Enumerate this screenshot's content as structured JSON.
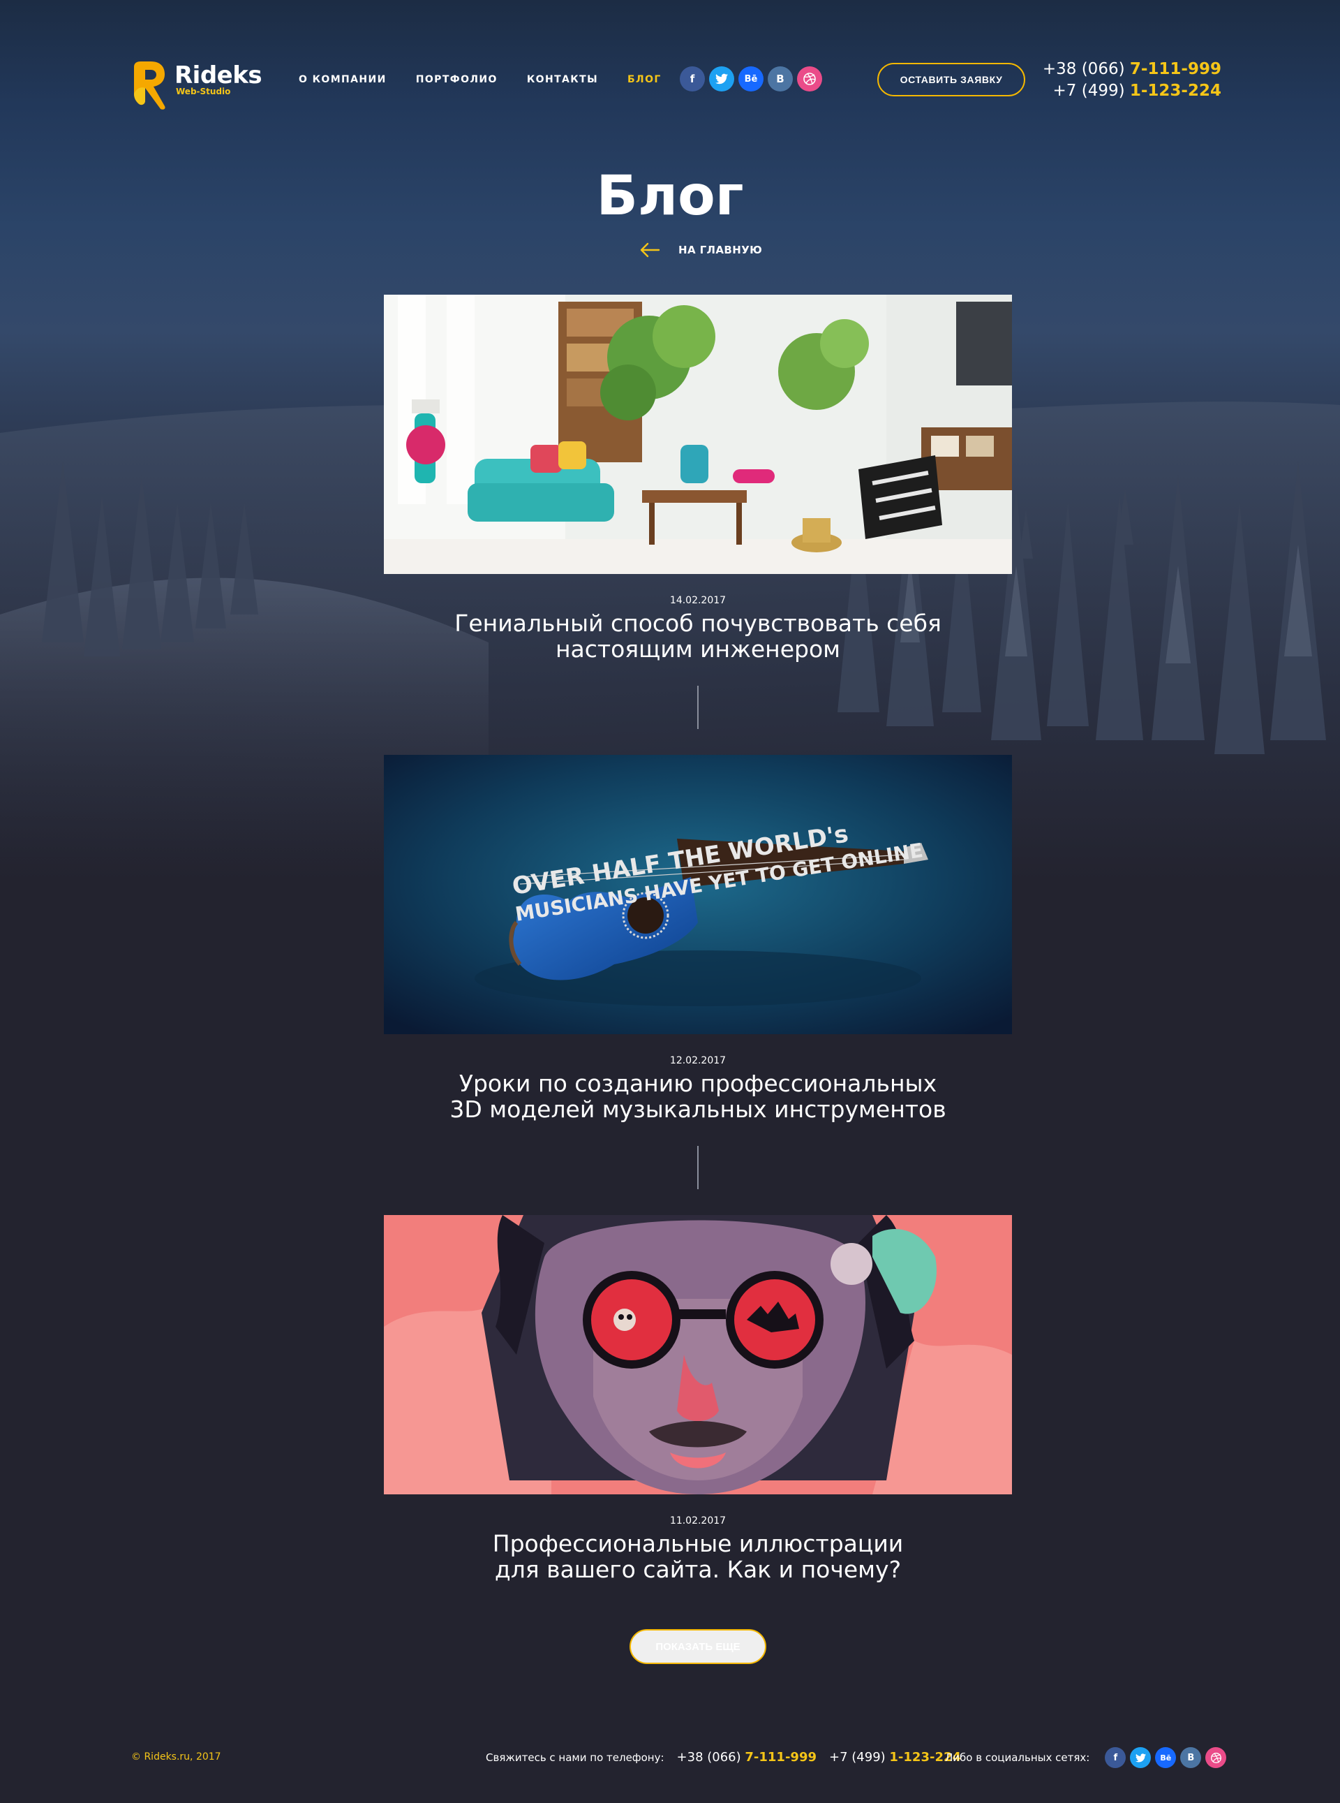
{
  "header": {
    "logo_name": "Rideks",
    "logo_sub": "Web-Studio",
    "nav": [
      {
        "label": "О КОМПАНИИ",
        "active": false
      },
      {
        "label": "ПОРТФОЛИО",
        "active": false
      },
      {
        "label": "КОНТАКТЫ",
        "active": false
      },
      {
        "label": "БЛОГ",
        "active": true
      }
    ],
    "social": [
      {
        "name": "facebook-icon",
        "glyph": "f"
      },
      {
        "name": "twitter-icon",
        "glyph": "t"
      },
      {
        "name": "behance-icon",
        "glyph": "Bē"
      },
      {
        "name": "vk-icon",
        "glyph": "B"
      },
      {
        "name": "dribbble-icon",
        "glyph": "◎"
      }
    ],
    "cta_label": "ОСТАВИТЬ ЗАЯВКУ",
    "phones": [
      {
        "prefix": "+38 (066) ",
        "number": "7-111-999"
      },
      {
        "prefix": "+7 (499) ",
        "number": "1-123-224"
      }
    ]
  },
  "page": {
    "title": "Блог",
    "back_label": "НА ГЛАВНУЮ"
  },
  "posts": [
    {
      "date": "14.02.2017",
      "title_line1": "Гениальный способ почувствовать себя",
      "title_line2": "настоящим инженером"
    },
    {
      "date": "12.02.2017",
      "title_line1": "Уроки по созданию профессиональных",
      "title_line2": "3D моделей музыкальных инструментов",
      "image_text_1": "OVER HALF THE WORLD's",
      "image_text_2": "MUSICIANS HAVE YET TO GET ONLINE"
    },
    {
      "date": "11.02.2017",
      "title_line1": "Профессиональные иллюстрации",
      "title_line2": "для вашего сайта. Как и почему?"
    }
  ],
  "more_label": "ПОКАЗАТЬ ЕЩЕ",
  "footer": {
    "copyright": "© Rideks.ru, 2017",
    "contact_label": "Свяжитесь с нами по телефону:",
    "phones": [
      {
        "prefix": "+38 (066) ",
        "number": "7-111-999"
      },
      {
        "prefix": "+7 (499) ",
        "number": "1-123-224"
      }
    ],
    "social_label": "Либо в социальных сетях:"
  },
  "colors": {
    "accent": "#f5c518",
    "background": "#23232f",
    "button_border": "#f5b800"
  }
}
